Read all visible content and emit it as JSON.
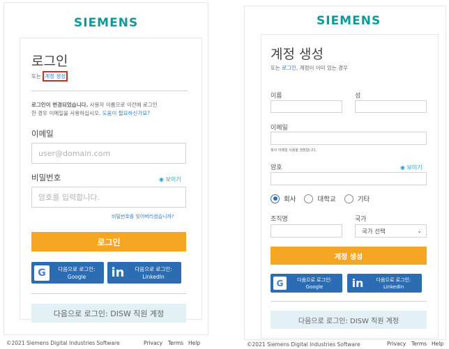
{
  "colors": {
    "brand": "#0f9a9a",
    "accent": "#f5a623",
    "sso_blue": "#2b6cb3",
    "disw_bg": "#e3f0f6",
    "link": "#3a7dbf",
    "highlight": "#d42a2a"
  },
  "login": {
    "logo": "SIEMENS",
    "title": "로그인",
    "or_prefix": "또는",
    "create_link": "계정 생성",
    "notice_bold": "로그인이 변경되었습니다.",
    "notice_line1_rest": " 사용자 이름으로 이전에 로그인",
    "notice_line2": "한 경우 이메일을 사용하십시오.",
    "notice_help_link": "도움이 필요하신가요?",
    "email_label": "이메일",
    "email_placeholder": "user@domain.com",
    "password_label": "비밀번호",
    "show_label": "보이기",
    "password_placeholder": "암호를 입력합니다.",
    "forgot_link": "비밀번호를 잊어버리셨습니까?",
    "login_button": "로그인",
    "google_line1": "다음으로 로그인:",
    "google_line2": "Google",
    "linkedin_line1": "다음으로 로그인:",
    "linkedin_line2": "LinkedIn",
    "disw_button": "다음으로 로그인: DISW 직원 계정",
    "copyright": "©2021 Siemens Digital Industries Software",
    "privacy": "Privacy",
    "terms": "Terms",
    "help": "Help"
  },
  "signup": {
    "logo": "SIEMENS",
    "title": "계정 생성",
    "or_prefix": "또는",
    "login_link": "로그인",
    "suffix": ", 계정이 이미 있는 경우",
    "first_name_label": "이름",
    "last_name_label": "성",
    "email_label": "이메일",
    "email_hint": "회사 이메일 사용을 권장합니다.",
    "password_label": "암호",
    "show_label": "보이기",
    "radio_company": "회사",
    "radio_university": "대학교",
    "radio_other": "기타",
    "org_label": "조직명",
    "country_label": "국가",
    "country_select": "국가 선택",
    "create_button": "계정 생성",
    "google_line1": "다음으로 로그인:",
    "google_line2": "Google",
    "linkedin_line1": "다음으로 로그인:",
    "linkedin_line2": "LinkedIn",
    "disw_button": "다음으로 로그인: DISW 직원 계정",
    "copyright": "©2021 Siemens Digital Industries Software",
    "privacy": "Privacy",
    "terms": "Terms",
    "help": "Help"
  }
}
